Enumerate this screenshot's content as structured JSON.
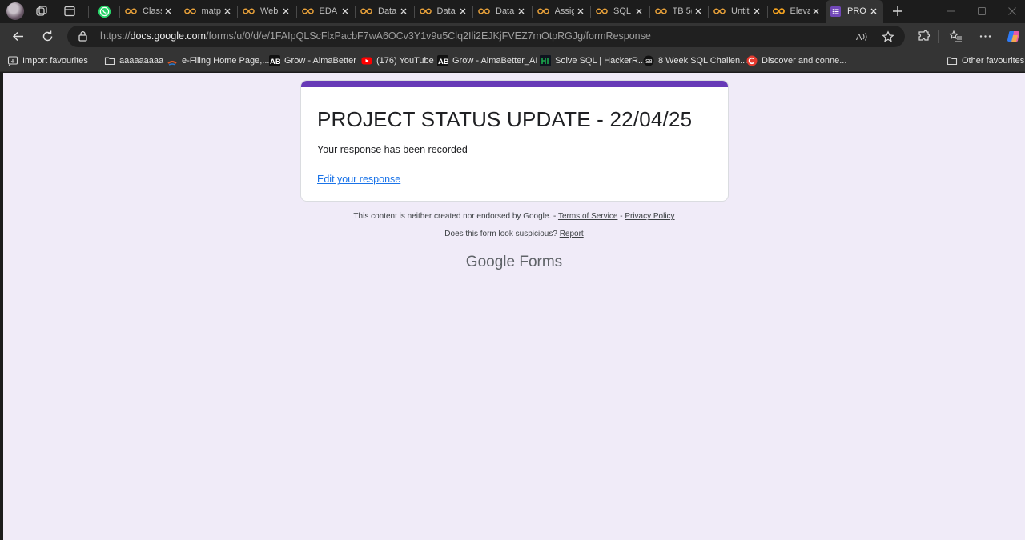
{
  "tabs": [
    {
      "title": "Class",
      "favicon": "infinity-icon",
      "active": false
    },
    {
      "title": "matp",
      "favicon": "infinity-icon",
      "active": false
    },
    {
      "title": "Web",
      "favicon": "infinity-icon",
      "active": false
    },
    {
      "title": "EDA",
      "favicon": "infinity-icon",
      "active": false
    },
    {
      "title": "Data",
      "favicon": "infinity-icon",
      "active": false
    },
    {
      "title": "Data",
      "favicon": "infinity-icon",
      "active": false
    },
    {
      "title": "Data",
      "favicon": "infinity-icon",
      "active": false
    },
    {
      "title": "Assig",
      "favicon": "infinity-icon",
      "active": false
    },
    {
      "title": "SQL",
      "favicon": "infinity-icon",
      "active": false
    },
    {
      "title": "TB 5(",
      "favicon": "infinity-icon",
      "active": false
    },
    {
      "title": "Untit",
      "favicon": "infinity-icon",
      "active": false
    },
    {
      "title": "Eleva",
      "favicon": "infinity-icon",
      "active": false
    },
    {
      "title": "PROJ",
      "favicon": "google-forms-icon",
      "active": true
    }
  ],
  "address_bar": {
    "url_prefix": "https://",
    "url_host": "docs.google.com",
    "url_path": "/forms/u/0/d/e/1FAIpQLScFlxPacbF7wA6OCv3Y1v9u5Clq2Ili2EJKjFVEZ7mOtpRGJg/formResponse"
  },
  "bookmarks": {
    "items": [
      {
        "label": "Import favourites",
        "icon": "import-icon"
      },
      {
        "label": "aaaaaaaaa",
        "icon": "folder-icon"
      },
      {
        "label": "e-Filing Home Page,...",
        "icon": "efiling-icon"
      },
      {
        "label": "Grow - AlmaBetter",
        "icon": "almabetter-icon"
      },
      {
        "label": "(176) YouTube",
        "icon": "youtube-icon"
      },
      {
        "label": "Grow - AlmaBetter_AI",
        "icon": "almabetter-icon"
      },
      {
        "label": "Solve SQL | HackerR...",
        "icon": "hackerrank-icon"
      },
      {
        "label": "8 Week SQL Challen...",
        "icon": "sql-challenge-icon"
      },
      {
        "label": "Discover and conne...",
        "icon": "discover-icon"
      }
    ],
    "other_label": "Other favourites"
  },
  "form": {
    "title": "PROJECT STATUS UPDATE - 22/04/25",
    "message": "Your response has been recorded",
    "edit_link": "Edit your response",
    "accent_color": "#673ab7"
  },
  "footer": {
    "disclaimer": "This content is neither created nor endorsed by Google.",
    "dash1": " - ",
    "terms": "Terms of Service",
    "dash2": " - ",
    "privacy": "Privacy Policy",
    "suspicious": "Does this form look suspicious?",
    "report": "Report",
    "brand_google": "Google",
    "brand_forms": "Forms"
  }
}
